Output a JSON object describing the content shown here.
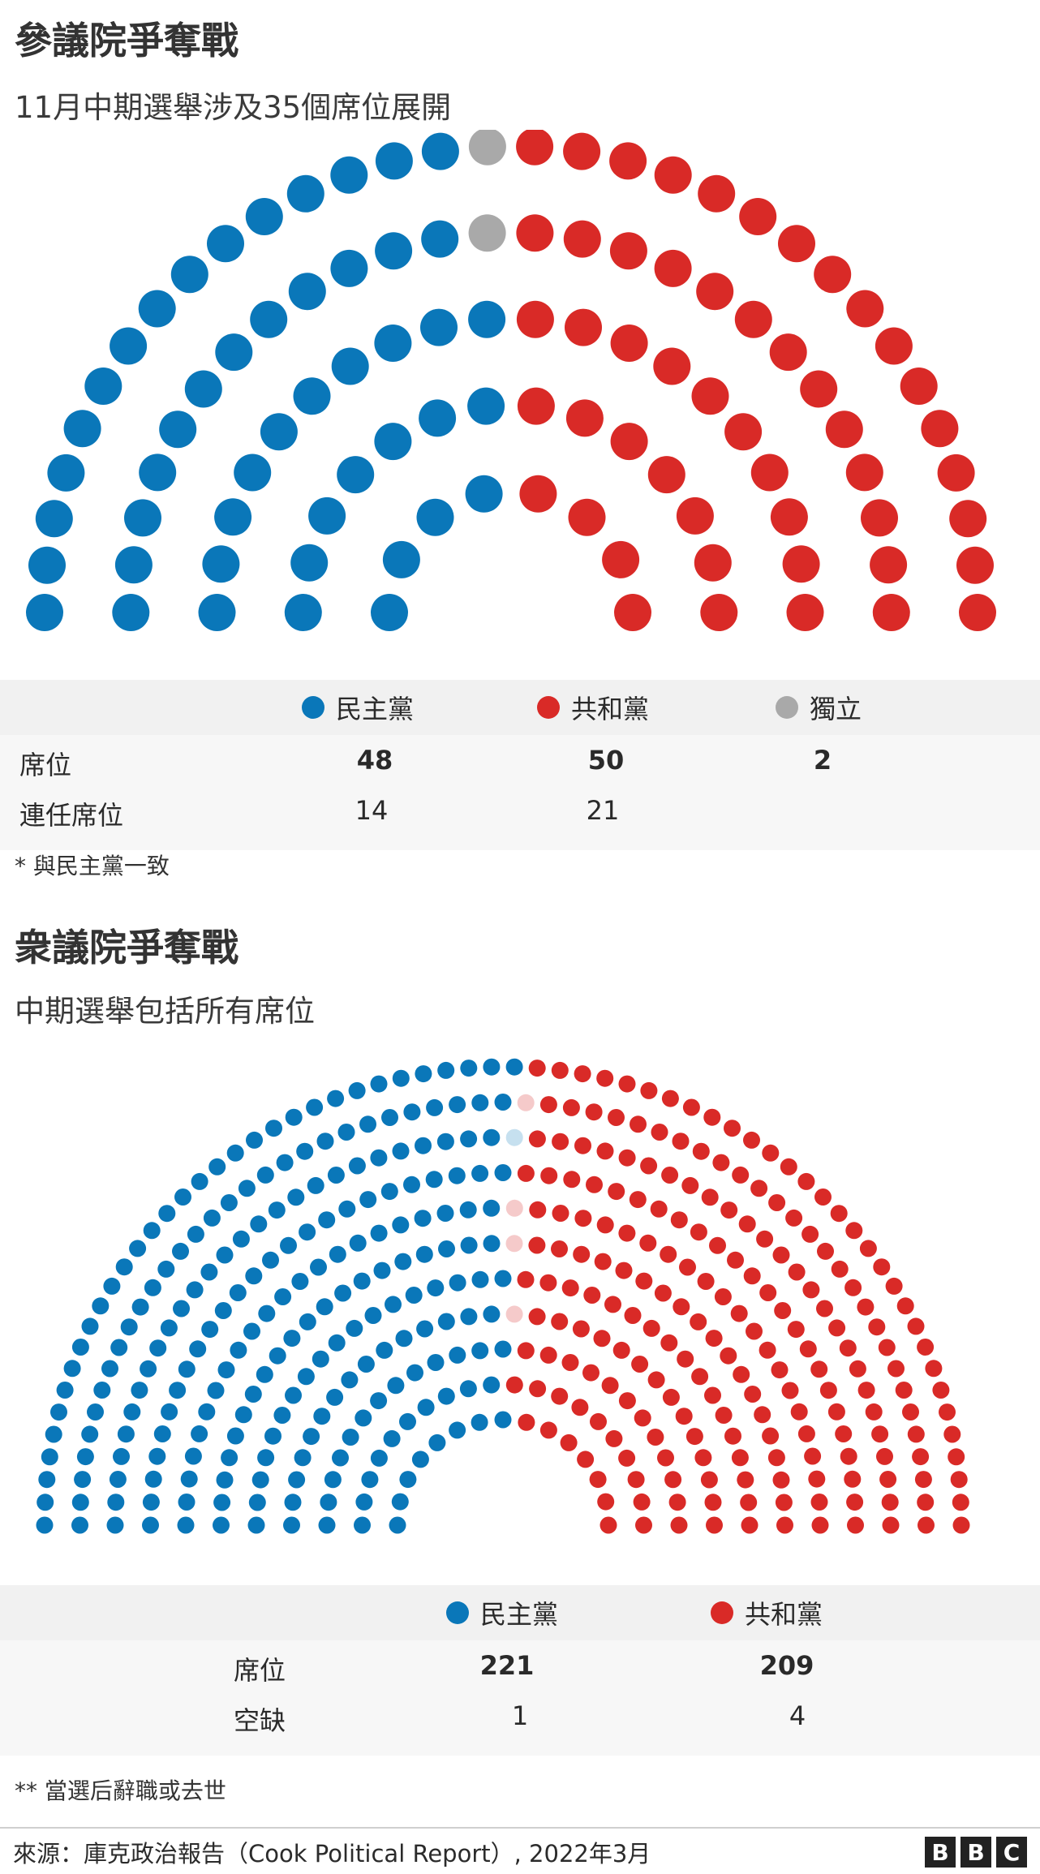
{
  "colors": {
    "dem": "#0a77b9",
    "rep": "#d92a27",
    "ind": "#a9a9a9",
    "dem_vacant": "#c6e0ef",
    "rep_vacant": "#f5caca"
  },
  "senate": {
    "title": "參議院爭奪戰",
    "subtitle": "11月中期選舉涉及35個席位展開",
    "legend": [
      "民主黨",
      "共和黨",
      "獨立"
    ],
    "row_labels": [
      "席位",
      "連任席位"
    ],
    "seats": [
      "48",
      "50",
      "2"
    ],
    "up_for_election": [
      "14",
      "21",
      ""
    ],
    "note": "* 與民主黨一致"
  },
  "house": {
    "title": "衆議院爭奪戰",
    "subtitle": "中期選舉包括所有席位",
    "legend": [
      "民主黨",
      "共和黨"
    ],
    "row_labels": [
      "席位",
      "空缺"
    ],
    "seats": [
      "221",
      "209"
    ],
    "vacant": [
      "1",
      "4"
    ],
    "note": "** 當選后辭職或去世"
  },
  "chart_data": [
    {
      "type": "parliament",
      "title": "參議院爭奪戰",
      "subtitle": "11月中期選舉涉及35個席位展開",
      "series": [
        {
          "name": "民主黨",
          "values": [
            48
          ]
        },
        {
          "name": "獨立",
          "values": [
            2
          ]
        },
        {
          "name": "共和黨",
          "values": [
            50
          ]
        }
      ]
    },
    {
      "type": "parliament",
      "title": "衆議院爭奪戰",
      "subtitle": "中期選舉包括所有席位",
      "series": [
        {
          "name": "民主黨",
          "values": [
            221
          ]
        },
        {
          "name": "民主黨 空缺",
          "values": [
            1
          ]
        },
        {
          "name": "共和黨 空缺",
          "values": [
            4
          ]
        },
        {
          "name": "共和黨",
          "values": [
            209
          ]
        }
      ]
    }
  ],
  "footer": {
    "source": "來源：庫克政治報告（Cook Political Report）, 2022年3月",
    "logo": "BBC"
  }
}
